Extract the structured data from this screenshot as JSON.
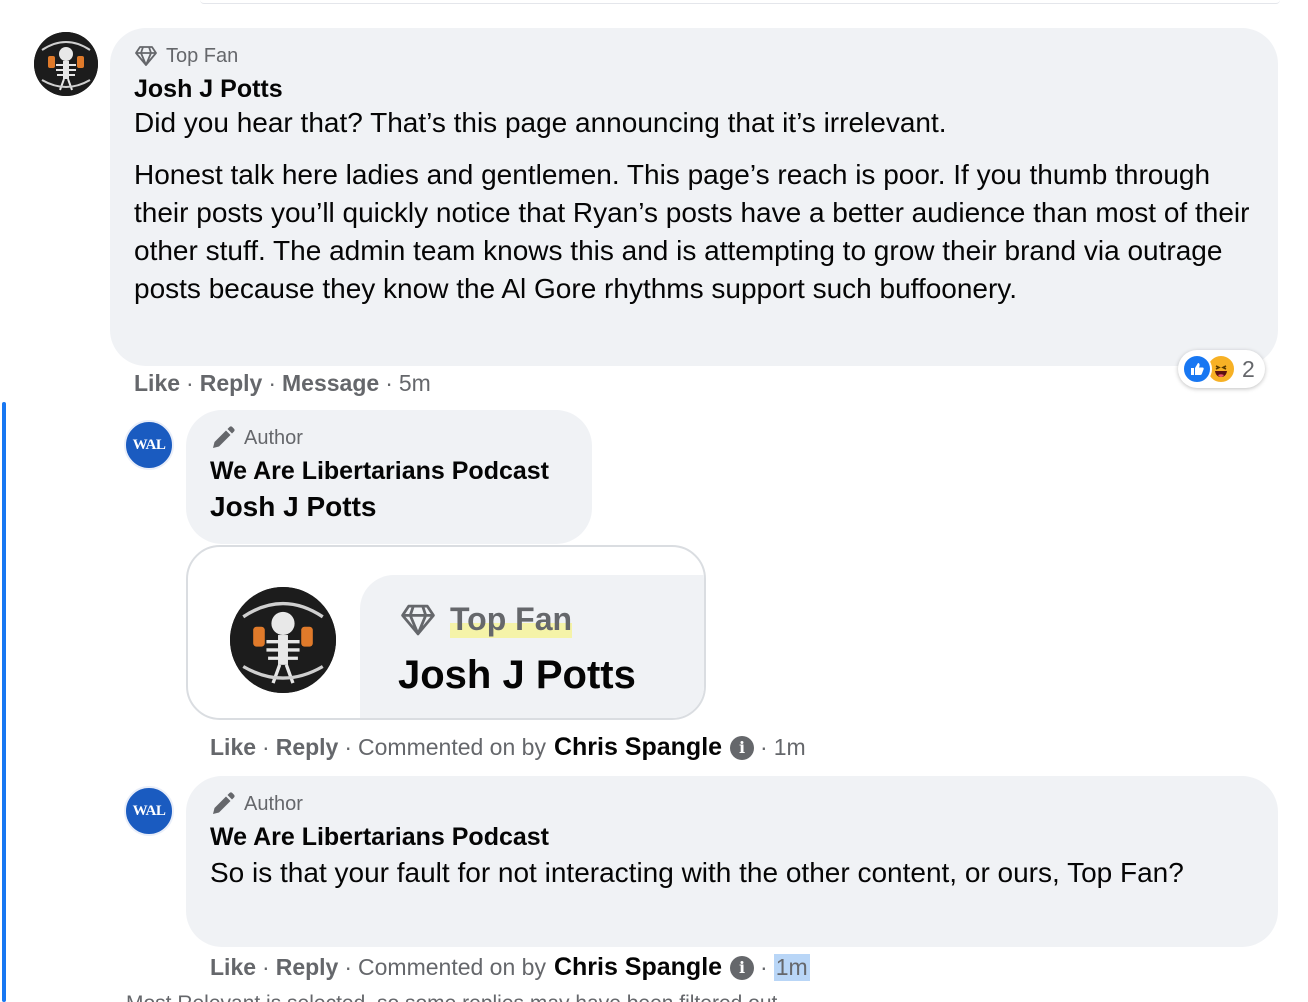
{
  "comment1": {
    "badge": "Top Fan",
    "author": "Josh J Potts",
    "paragraphs": [
      "Did you hear that? That’s this page announcing that it’s irrelevant.",
      "Honest talk here ladies and gentlemen. This page’s reach is poor. If you thumb through their posts you’ll quickly notice that Ryan’s posts have a better audience than most of their other stuff. The admin team knows this and is attempting to grow their brand via outrage posts because they know the Al Gore rhythms support such buffoonery."
    ],
    "actions": {
      "like": "Like",
      "reply": "Reply",
      "message": "Message",
      "time": "5m"
    },
    "reactions": {
      "count": "2"
    }
  },
  "reply1": {
    "avatar_text": "WAL",
    "badge": "Author",
    "author": "We Are Libertarians Podcast",
    "mention": "Josh J Potts",
    "embed": {
      "badge": "Top Fan",
      "name": "Josh J Potts"
    },
    "actions": {
      "like": "Like",
      "reply": "Reply",
      "commented_on_by": "Commented on by",
      "commenter": "Chris Spangle",
      "time": "1m"
    }
  },
  "reply2": {
    "avatar_text": "WAL",
    "badge": "Author",
    "author": "We Are Libertarians Podcast",
    "text": "So is that your fault for not interacting with the other content, or ours, Top Fan?",
    "actions": {
      "like": "Like",
      "reply": "Reply",
      "commented_on_by": "Commented on by",
      "commenter": "Chris Spangle",
      "time": "1m"
    }
  },
  "footer_note": "Most Relevant is selected, so some replies may have been filtered out.",
  "colors": {
    "thread_line": "#1877f2",
    "bubble": "#f0f2f5",
    "secondary_text": "#65676b",
    "wal_blue": "#1a5bc0"
  }
}
